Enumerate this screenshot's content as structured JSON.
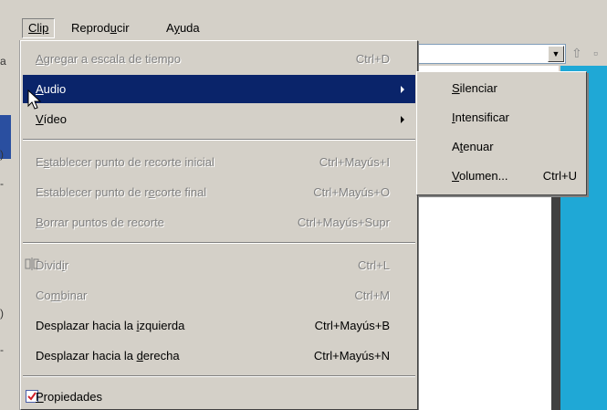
{
  "menubar": {
    "items": [
      {
        "label": "Clip",
        "accel_index": 0
      },
      {
        "label": "Reproducir",
        "accel_index": 6
      },
      {
        "label": "Ayuda",
        "accel_index": 1
      }
    ]
  },
  "left_strip": {
    "marks": [
      "a",
      ")",
      "-",
      ")",
      "-"
    ]
  },
  "menu": {
    "items": [
      {
        "pre": "",
        "u": "A",
        "post": "gregar a escala de tiempo",
        "shortcut": "Ctrl+D"
      },
      {
        "pre": "",
        "u": "A",
        "post": "udio",
        "shortcut": ""
      },
      {
        "pre": "",
        "u": "V",
        "post": "ídeo",
        "shortcut": ""
      },
      {
        "pre": "E",
        "u": "s",
        "post": "tablecer punto de recorte inicial",
        "shortcut": "Ctrl+Mayús+I"
      },
      {
        "pre": "Establecer punto de r",
        "u": "e",
        "post": "corte final",
        "shortcut": "Ctrl+Mayús+O"
      },
      {
        "pre": "",
        "u": "B",
        "post": "orrar puntos de recorte",
        "shortcut": "Ctrl+Mayús+Supr"
      },
      {
        "pre": "Divid",
        "u": "i",
        "post": "r",
        "shortcut": "Ctrl+L"
      },
      {
        "pre": "Co",
        "u": "m",
        "post": "binar",
        "shortcut": "Ctrl+M"
      },
      {
        "pre": "Desplazar hacia la ",
        "u": "i",
        "post": "zquierda",
        "shortcut": "Ctrl+Mayús+B"
      },
      {
        "pre": "Desplazar hacia la ",
        "u": "d",
        "post": "erecha",
        "shortcut": "Ctrl+Mayús+N"
      },
      {
        "pre": "",
        "u": "P",
        "post": "ropiedades",
        "shortcut": ""
      }
    ]
  },
  "submenu": {
    "items": [
      {
        "pre": "",
        "u": "S",
        "post": "ilenciar",
        "shortcut": ""
      },
      {
        "pre": "",
        "u": "I",
        "post": "ntensificar",
        "shortcut": ""
      },
      {
        "pre": "A",
        "u": "t",
        "post": "enuar",
        "shortcut": ""
      },
      {
        "pre": "",
        "u": "V",
        "post": "olumen...",
        "shortcut": "Ctrl+U"
      }
    ]
  },
  "colors": {
    "highlight": "#0a246a",
    "menu_bg": "#d4d0c8",
    "content_blue": "#1fa8d6"
  },
  "icons": {
    "split": "split-icon",
    "properties": "properties-check-icon",
    "cursor": "mouse-pointer-icon",
    "combo_arrow": "chevron-down-icon",
    "toolbar": "up-arrow-icon"
  }
}
